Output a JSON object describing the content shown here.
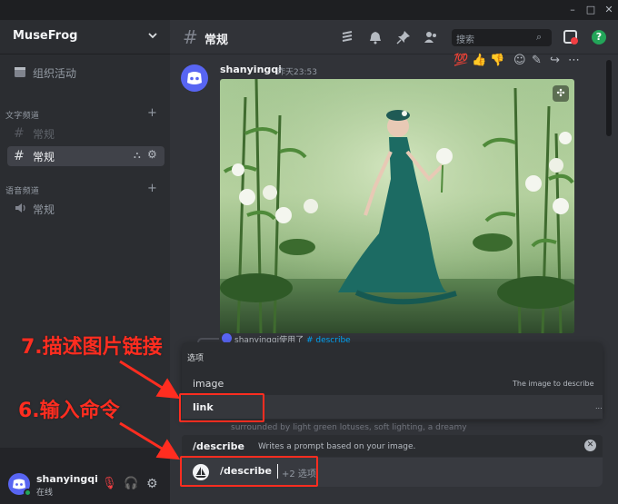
{
  "window": {
    "minimize": "–",
    "maximize": "□",
    "close": "✕"
  },
  "server": {
    "name": "MuseFrog"
  },
  "sidebar": {
    "activity_label": "组织活动",
    "text_category": "文字频道",
    "voice_category": "语音频道",
    "text_channels": [
      {
        "label": "常规"
      },
      {
        "label": "常规"
      }
    ],
    "voice_channels": [
      {
        "label": "常规"
      }
    ]
  },
  "user": {
    "name": "shanyingqi",
    "status": "在线"
  },
  "channel": {
    "title": "常规",
    "search_placeholder": "搜索"
  },
  "message": {
    "author": "shanyingqi",
    "time": "昨天23:53",
    "reactions": [
      "💯",
      "👍",
      "👎"
    ]
  },
  "interaction": {
    "user": "shanyingqi",
    "used": "使用了",
    "command": "# describe"
  },
  "options_popup": {
    "header": "选项",
    "items": [
      {
        "label": "image",
        "description": "The image to describe"
      },
      {
        "label": "link",
        "description": "..."
      }
    ]
  },
  "background_text": "surrounded by light green lotuses, soft lighting, a dreamy",
  "command_suggestion": {
    "name": "/describe",
    "description": "Writes a prompt based on your image."
  },
  "input": {
    "command": "/describe",
    "more_options": "+2 选项"
  },
  "annotations": {
    "step7": "7.描述图片链接",
    "step6": "6.输入命令"
  },
  "colors": {
    "annotation": "#ff2d20",
    "accent": "#5865f2",
    "online": "#23a559"
  }
}
